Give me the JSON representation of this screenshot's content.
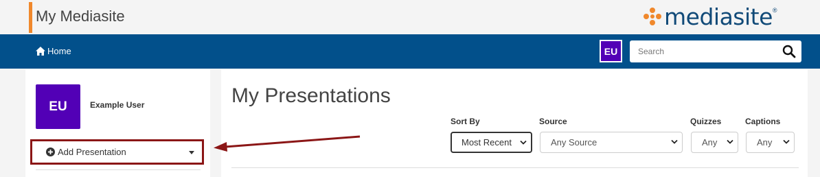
{
  "header": {
    "app_title": "My Mediasite",
    "logo_text": "mediasite",
    "logo_mark": "®",
    "accent_color": "#f0882c",
    "brand_color": "#114a78"
  },
  "navbar": {
    "home_label": "Home",
    "avatar_initials": "EU",
    "search_placeholder": "Search",
    "background_color": "#02508b",
    "avatar_color": "#5200b6"
  },
  "sidebar": {
    "avatar_initials": "EU",
    "user_name": "Example User",
    "add_presentation_label": "Add Presentation"
  },
  "main": {
    "title": "My Presentations",
    "filters": {
      "sort_by": {
        "label": "Sort By",
        "value": "Most Recent"
      },
      "source": {
        "label": "Source",
        "value": "Any Source"
      },
      "quizzes": {
        "label": "Quizzes",
        "value": "Any"
      },
      "captions": {
        "label": "Captions",
        "value": "Any"
      }
    }
  },
  "annotation": {
    "color": "#8b1616"
  },
  "icons": [
    "home-icon",
    "search-icon",
    "plus-circle-icon",
    "caret-down-icon",
    "chevron-down-icon",
    "orange-dots-logo-icon"
  ]
}
